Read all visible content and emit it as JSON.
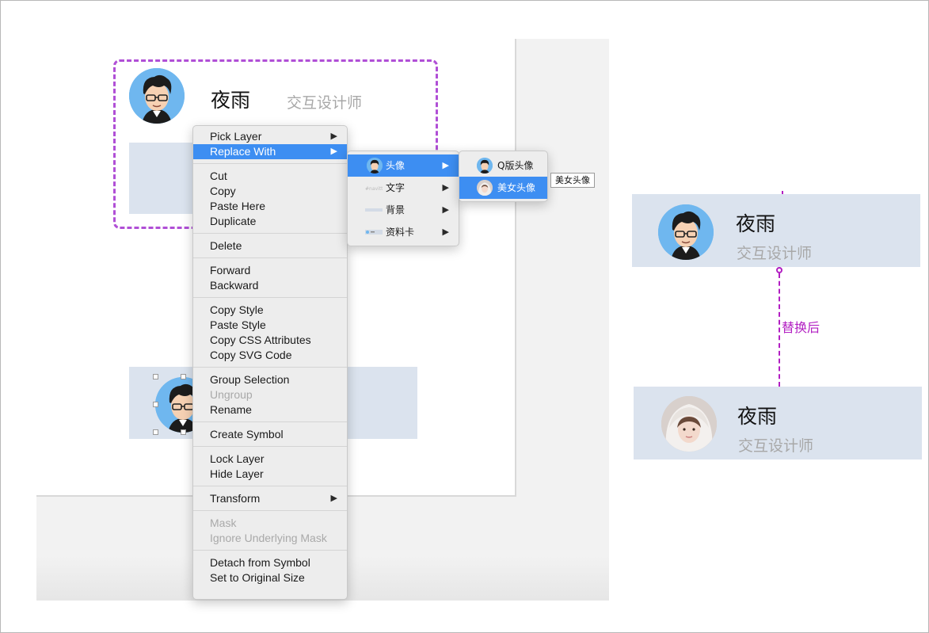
{
  "canvas": {
    "profile_card": {
      "name": "夜雨",
      "role": "交互设计师"
    }
  },
  "context_menu": {
    "groups": [
      [
        {
          "label": "Pick Layer",
          "submenu": true
        },
        {
          "label": "Replace With",
          "submenu": true,
          "active": true
        }
      ],
      [
        {
          "label": "Cut"
        },
        {
          "label": "Copy"
        },
        {
          "label": "Paste Here"
        },
        {
          "label": "Duplicate"
        }
      ],
      [
        {
          "label": "Delete"
        }
      ],
      [
        {
          "label": "Forward"
        },
        {
          "label": "Backward"
        }
      ],
      [
        {
          "label": "Copy Style"
        },
        {
          "label": "Paste Style"
        },
        {
          "label": "Copy CSS Attributes"
        },
        {
          "label": "Copy SVG Code"
        }
      ],
      [
        {
          "label": "Group Selection"
        },
        {
          "label": "Ungroup",
          "disabled": true
        },
        {
          "label": "Rename"
        }
      ],
      [
        {
          "label": "Create Symbol"
        }
      ],
      [
        {
          "label": "Lock Layer"
        },
        {
          "label": "Hide Layer"
        }
      ],
      [
        {
          "label": "Transform",
          "submenu": true
        }
      ],
      [
        {
          "label": "Mask",
          "disabled": true
        },
        {
          "label": "Ignore Underlying Mask",
          "disabled": true
        }
      ],
      [
        {
          "label": "Detach from Symbol"
        },
        {
          "label": "Set to Original Size"
        }
      ]
    ]
  },
  "replace_submenu": {
    "items": [
      {
        "label": "头像",
        "icon": "avatar-icon",
        "active": true
      },
      {
        "label": "文字",
        "icon": "text-symbol-icon"
      },
      {
        "label": "背景",
        "icon": "background-symbol-icon"
      },
      {
        "label": "资料卡",
        "icon": "profile-card-symbol-icon"
      }
    ]
  },
  "avatar_submenu": {
    "items": [
      {
        "label": "Q版头像",
        "icon": "cartoon-avatar-icon"
      },
      {
        "label": "美女头像",
        "icon": "female-avatar-icon",
        "active": true
      }
    ]
  },
  "tooltip": "美女头像",
  "comparison": {
    "before_card": {
      "name": "夜雨",
      "role": "交互设计师"
    },
    "after_label": "替换后",
    "after_card": {
      "name": "夜雨",
      "role": "交互设计师"
    }
  },
  "colors": {
    "selection_dash": "#b04fd6",
    "menu_highlight": "#3d8ef2",
    "card_background": "#dbe3ee",
    "annotation": "#b21ec2"
  }
}
